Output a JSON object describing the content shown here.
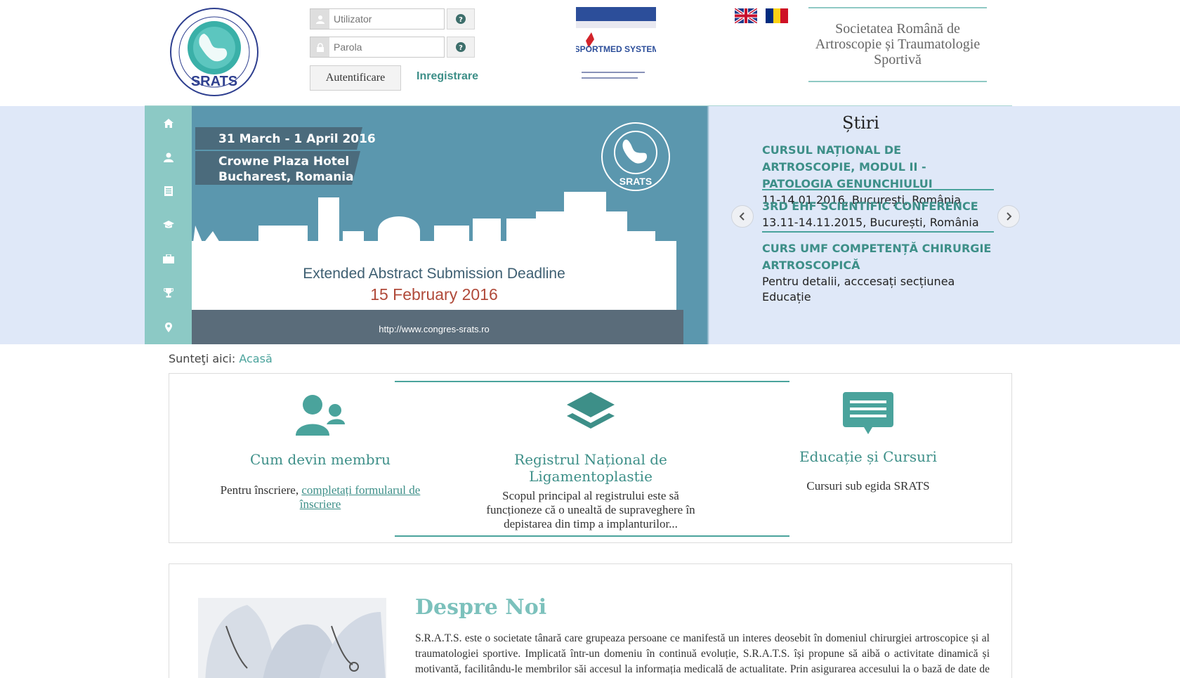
{
  "header": {
    "logo_text": "SRATS",
    "username_placeholder": "Utilizator",
    "password_placeholder": "Parola",
    "login_button": "Autentificare",
    "register_link": "Inregistrare",
    "society_name": "Societatea Română de Artroscopie și Traumatologie Sportivă",
    "sponsor_text": "SPORTMED SYSTEMS"
  },
  "sidenav": {
    "items": [
      "home-icon",
      "user-icon",
      "document-icon",
      "graduation-icon",
      "briefcase-icon",
      "trophy-icon",
      "map-marker-icon"
    ]
  },
  "hero": {
    "date": "31 March - 1 April 2016",
    "venue_line1": "Crowne Plaza Hotel",
    "venue_line2": "Bucharest, Romania",
    "deadline_label": "Extended Abstract Submission Deadline",
    "deadline_date": "15 February 2016",
    "url": "http://www.congres-srats.ro",
    "logo_text": "SRATS"
  },
  "news": {
    "title": "Știri",
    "items": [
      {
        "title": "CURSUL NAȚIONAL DE ARTROSCOPIE, MODUL II - PATOLOGIA GENUNCHIULUI",
        "detail": "11-14.01.2016, București, România"
      },
      {
        "title": "3RD EHF SCIENTIFIC CONFERENCE",
        "detail": "13.11-14.11.2015, București, România"
      },
      {
        "title": "CURS UMF COMPETENȚĂ CHIRURGIE ARTROSCOPICĂ",
        "detail": "Pentru detalii, acccesați secțiunea Educație"
      }
    ]
  },
  "breadcrumb": {
    "label": "Sunteţi aici:",
    "link": "Acasă"
  },
  "features": [
    {
      "title": "Cum devin membru",
      "desc_prefix": "Pentru înscriere, ",
      "desc_link": "completați formularul de înscriere",
      "desc": ""
    },
    {
      "title": "Registrul Național de Ligamentoplastie",
      "desc": "Scopul principal al registrului este să funcționeze că o unealtă de supraveghere în depistarea din timp a implanturilor..."
    },
    {
      "title": "Educație și Cursuri",
      "desc": "Cursuri sub egida SRATS"
    }
  ],
  "about": {
    "title": "Despre Noi",
    "text": "S.R.A.T.S. este o societate tânară care grupeaza persoane ce manifestă un interes deosebit în domeniul chirurgiei artroscopice și al traumatologiei sportive. Implicată într-un domeniu în continuă evoluție, S.R.A.T.S. își propune să aibă o activitate dinamică și motivantă, facilitându-le membrilor săi accesul la informația medicală de actualitate. Prin asigurarea accesului la o bază de date de renume, organizarea de cursuri și congrese și crearea unei videoteci on-line, se urmărește îmbunătățirea calității actului"
  },
  "colors": {
    "teal": "#4aa39c",
    "band": "#dfe8f8",
    "sidenav": "#8cc9c5",
    "hero": "#5b97ae"
  }
}
